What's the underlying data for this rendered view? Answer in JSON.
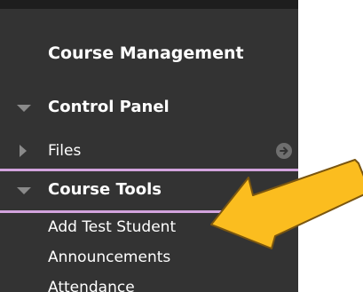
{
  "menu": {
    "heading": "Course Management",
    "control_panel": "Control Panel",
    "files": "Files",
    "course_tools": "Course Tools",
    "items": [
      "Add Test Student",
      "Announcements",
      "Attendance"
    ]
  },
  "icons": {
    "collapse": "triangle-down-icon",
    "expand": "triangle-right-icon",
    "go": "circle-arrow-right-icon",
    "callout": "yellow-arrow-pointer"
  },
  "colors": {
    "panel": "#333333",
    "divider": "#d2a3dd",
    "arrow_fill": "#fbbd1f",
    "arrow_outline": "#7a5610"
  }
}
